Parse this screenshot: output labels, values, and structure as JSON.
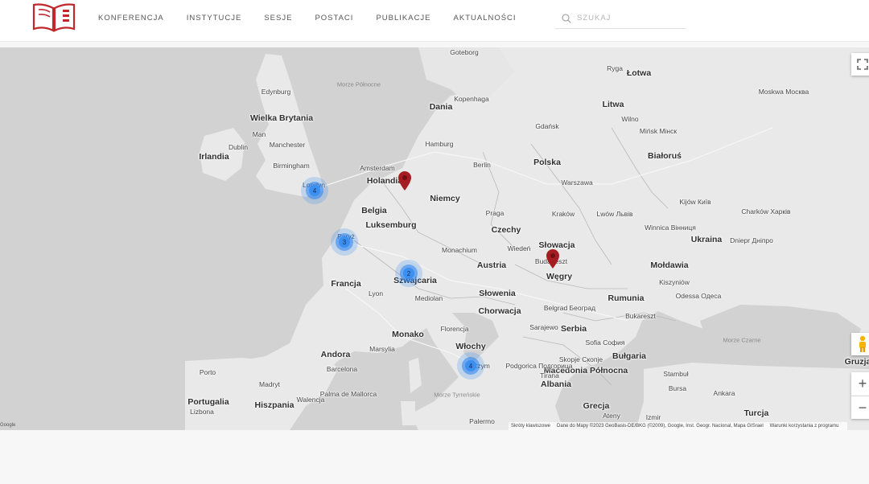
{
  "header": {
    "nav": [
      "KONFERENCJA",
      "INSTYTUCJE",
      "SESJE",
      "POSTACI",
      "PUBLIKACJE",
      "AKTUALNOŚCI"
    ],
    "search_placeholder": "SZUKAJ",
    "logo_icon": "book-icon",
    "accent_color": "#c0282d"
  },
  "map": {
    "countries": [
      "Wielka Brytania",
      "Irlandia",
      "Dania",
      "Litwa",
      "Łotwa",
      "Białoruś",
      "Polska",
      "Holandia",
      "Niemcy",
      "Belgia",
      "Luksemburg",
      "Czechy",
      "Słowacja",
      "Ukraina",
      "Francja",
      "Szwajcaria",
      "Austria",
      "Węgry",
      "Mołdawia",
      "Słowenia",
      "Chorwacja",
      "Rumunia",
      "Serbia",
      "Monako",
      "Andora",
      "Włochy",
      "Bułgaria",
      "Macedonia Północna",
      "Albania",
      "Portugalia",
      "Hiszpania",
      "Grecja",
      "Turcja",
      "Gruzja"
    ],
    "cities": [
      "Edynburg",
      "Man",
      "Manchester",
      "Dublin",
      "Birmingham",
      "Londyn",
      "Paryż",
      "Lyon",
      "Marsylia",
      "Amsterdam",
      "Hamburg",
      "Berlin",
      "Kopenhaga",
      "Goteborg",
      "Ryga",
      "Wilno",
      "Mińsk Мінск",
      "Gdańsk",
      "Warszawa",
      "Kraków",
      "Praga",
      "Monachium",
      "Wiedeń",
      "Budapeszt",
      "Lwów Львів",
      "Winnica Вінниця",
      "Kijów Київ",
      "Charków Харків",
      "Dniepr Дніпро",
      "Kiszyniów",
      "Odessa Одеса",
      "Bukareszt",
      "Mediolan",
      "Florencja",
      "Rzym",
      "Sarajewo",
      "Belgrad Београд",
      "Podgorica Подгорица",
      "Sofia София",
      "Tirana",
      "Skopje Скопје",
      "Stambuł",
      "Bursa",
      "Ankara",
      "Izmir",
      "Ateny",
      "Palermo",
      "Porto",
      "Madryt",
      "Lizbona",
      "Walencja",
      "Barcelona",
      "Palma de Mallorca",
      "Moskwa Москва"
    ],
    "seas": [
      "Morze Północne",
      "Morze Czarne",
      "Morze Tyrreńskie"
    ],
    "clusters": [
      {
        "label": "4",
        "name": "cluster-london"
      },
      {
        "label": "3",
        "name": "cluster-paris"
      },
      {
        "label": "2",
        "name": "cluster-switzerland"
      },
      {
        "label": "4",
        "name": "cluster-rome"
      }
    ],
    "pin_color": "#a51d22",
    "cluster_color": "#3b8ff0",
    "attribution": {
      "shortcuts": "Skróty klawiszowe",
      "data": "Dane do Mapy ©2023 GeoBasis-DE/BKG (©2009), Google, Inst. Geogr. Nacional, Mapa GISrael",
      "terms": "Warunki korzystania z programu"
    },
    "google_label": "Google"
  }
}
